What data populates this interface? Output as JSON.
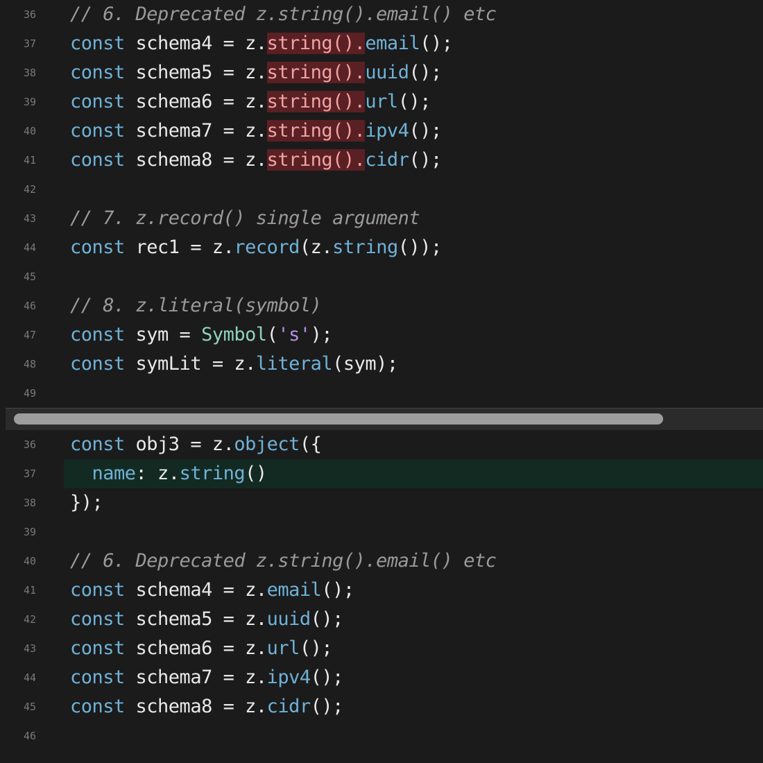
{
  "panes": {
    "original": {
      "lines": [
        {
          "num": "36",
          "highlight": false,
          "tokens": [
            {
              "t": "// 6. Deprecated z.string().email() etc",
              "c": "comment"
            }
          ]
        },
        {
          "num": "37",
          "highlight": false,
          "tokens": [
            {
              "t": "const",
              "c": "kw"
            },
            {
              "t": " schema4 = z.",
              "c": "plain"
            },
            {
              "t": "string().",
              "c": "del"
            },
            {
              "t": "email",
              "c": "fn"
            },
            {
              "t": "();",
              "c": "plain"
            }
          ]
        },
        {
          "num": "38",
          "highlight": false,
          "tokens": [
            {
              "t": "const",
              "c": "kw"
            },
            {
              "t": " schema5 = z.",
              "c": "plain"
            },
            {
              "t": "string().",
              "c": "del"
            },
            {
              "t": "uuid",
              "c": "fn"
            },
            {
              "t": "();",
              "c": "plain"
            }
          ]
        },
        {
          "num": "39",
          "highlight": false,
          "tokens": [
            {
              "t": "const",
              "c": "kw"
            },
            {
              "t": " schema6 = z.",
              "c": "plain"
            },
            {
              "t": "string().",
              "c": "del"
            },
            {
              "t": "url",
              "c": "fn"
            },
            {
              "t": "();",
              "c": "plain"
            }
          ]
        },
        {
          "num": "40",
          "highlight": false,
          "tokens": [
            {
              "t": "const",
              "c": "kw"
            },
            {
              "t": " schema7 = z.",
              "c": "plain"
            },
            {
              "t": "string().",
              "c": "del"
            },
            {
              "t": "ipv4",
              "c": "fn"
            },
            {
              "t": "();",
              "c": "plain"
            }
          ]
        },
        {
          "num": "41",
          "highlight": false,
          "tokens": [
            {
              "t": "const",
              "c": "kw"
            },
            {
              "t": " schema8 = z.",
              "c": "plain"
            },
            {
              "t": "string().",
              "c": "del"
            },
            {
              "t": "cidr",
              "c": "fn"
            },
            {
              "t": "();",
              "c": "plain"
            }
          ]
        },
        {
          "num": "42",
          "highlight": false,
          "tokens": []
        },
        {
          "num": "43",
          "highlight": false,
          "tokens": [
            {
              "t": "// 7. z.record() single argument",
              "c": "comment"
            }
          ]
        },
        {
          "num": "44",
          "highlight": false,
          "tokens": [
            {
              "t": "const",
              "c": "kw"
            },
            {
              "t": " rec1 = z.",
              "c": "plain"
            },
            {
              "t": "record",
              "c": "fn"
            },
            {
              "t": "(z.",
              "c": "plain"
            },
            {
              "t": "string",
              "c": "fn"
            },
            {
              "t": "());",
              "c": "plain"
            }
          ]
        },
        {
          "num": "45",
          "highlight": false,
          "tokens": []
        },
        {
          "num": "46",
          "highlight": false,
          "tokens": [
            {
              "t": "// 8. z.literal(symbol)",
              "c": "comment"
            }
          ]
        },
        {
          "num": "47",
          "highlight": false,
          "tokens": [
            {
              "t": "const",
              "c": "kw"
            },
            {
              "t": " sym = ",
              "c": "plain"
            },
            {
              "t": "Symbol",
              "c": "type"
            },
            {
              "t": "(",
              "c": "plain"
            },
            {
              "t": "'s'",
              "c": "str"
            },
            {
              "t": ");",
              "c": "plain"
            }
          ]
        },
        {
          "num": "48",
          "highlight": false,
          "tokens": [
            {
              "t": "const",
              "c": "kw"
            },
            {
              "t": " symLit = z.",
              "c": "plain"
            },
            {
              "t": "literal",
              "c": "fn"
            },
            {
              "t": "(sym);",
              "c": "plain"
            }
          ]
        },
        {
          "num": "49",
          "highlight": false,
          "tokens": []
        }
      ]
    },
    "modified": {
      "lines": [
        {
          "num": "36",
          "highlight": false,
          "tokens": [
            {
              "t": "const",
              "c": "kw"
            },
            {
              "t": " obj3 = z.",
              "c": "plain"
            },
            {
              "t": "object",
              "c": "fn"
            },
            {
              "t": "({",
              "c": "plain"
            }
          ]
        },
        {
          "num": "37",
          "highlight": true,
          "tokens": [
            {
              "t": "  ",
              "c": "plain"
            },
            {
              "t": "name",
              "c": "prop"
            },
            {
              "t": ": z.",
              "c": "plain"
            },
            {
              "t": "string",
              "c": "fn"
            },
            {
              "t": "()",
              "c": "plain"
            }
          ]
        },
        {
          "num": "38",
          "highlight": false,
          "tokens": [
            {
              "t": "});",
              "c": "plain"
            }
          ]
        },
        {
          "num": "39",
          "highlight": false,
          "tokens": []
        },
        {
          "num": "40",
          "highlight": false,
          "tokens": [
            {
              "t": "// 6. Deprecated z.string().email() etc",
              "c": "comment"
            }
          ]
        },
        {
          "num": "41",
          "highlight": false,
          "tokens": [
            {
              "t": "const",
              "c": "kw"
            },
            {
              "t": " schema4 = z.",
              "c": "plain"
            },
            {
              "t": "email",
              "c": "fn"
            },
            {
              "t": "();",
              "c": "plain"
            }
          ]
        },
        {
          "num": "42",
          "highlight": false,
          "tokens": [
            {
              "t": "const",
              "c": "kw"
            },
            {
              "t": " schema5 = z.",
              "c": "plain"
            },
            {
              "t": "uuid",
              "c": "fn"
            },
            {
              "t": "();",
              "c": "plain"
            }
          ]
        },
        {
          "num": "43",
          "highlight": false,
          "tokens": [
            {
              "t": "const",
              "c": "kw"
            },
            {
              "t": " schema6 = z.",
              "c": "plain"
            },
            {
              "t": "url",
              "c": "fn"
            },
            {
              "t": "();",
              "c": "plain"
            }
          ]
        },
        {
          "num": "44",
          "highlight": false,
          "tokens": [
            {
              "t": "const",
              "c": "kw"
            },
            {
              "t": " schema7 = z.",
              "c": "plain"
            },
            {
              "t": "ipv4",
              "c": "fn"
            },
            {
              "t": "();",
              "c": "plain"
            }
          ]
        },
        {
          "num": "45",
          "highlight": false,
          "tokens": [
            {
              "t": "const",
              "c": "kw"
            },
            {
              "t": " schema8 = z.",
              "c": "plain"
            },
            {
              "t": "cidr",
              "c": "fn"
            },
            {
              "t": "();",
              "c": "plain"
            }
          ]
        },
        {
          "num": "46",
          "highlight": false,
          "tokens": []
        }
      ]
    }
  },
  "scrollbar": {
    "position": 0.0,
    "visible_fraction": 0.86
  },
  "colors": {
    "background": "#1b1b1b",
    "keyword": "#6fb2d8",
    "comment": "#9a9a9a",
    "deleted_bg": "#5a2024",
    "added_line_bg": "#132a22",
    "string": "#b792e6"
  }
}
